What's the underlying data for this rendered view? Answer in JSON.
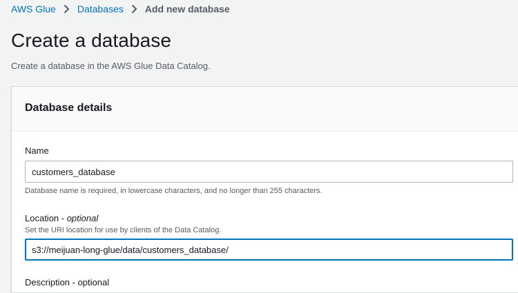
{
  "breadcrumb": {
    "items": [
      "AWS Glue",
      "Databases"
    ],
    "current": "Add new database"
  },
  "page": {
    "title": "Create a database",
    "description": "Create a database in the AWS Glue Data Catalog."
  },
  "panel": {
    "title": "Database details",
    "name_field": {
      "label": "Name",
      "value": "customers_database",
      "hint": "Database name is required, in lowercase characters, and no longer than 255 characters."
    },
    "location_field": {
      "label": "Location - ",
      "label_optional": "optional",
      "hint": "Set the URI location for use by clients of the Data Catalog.",
      "value": "s3://meijuan-long-glue/data/customers_database/"
    },
    "description_field": {
      "label": "Description - optional"
    }
  },
  "icons": {
    "breadcrumb_separator": "chevron-right-icon"
  },
  "colors": {
    "link": "#0073bb",
    "focus_border": "#0073bb",
    "page_background": "#f2f3f3"
  }
}
